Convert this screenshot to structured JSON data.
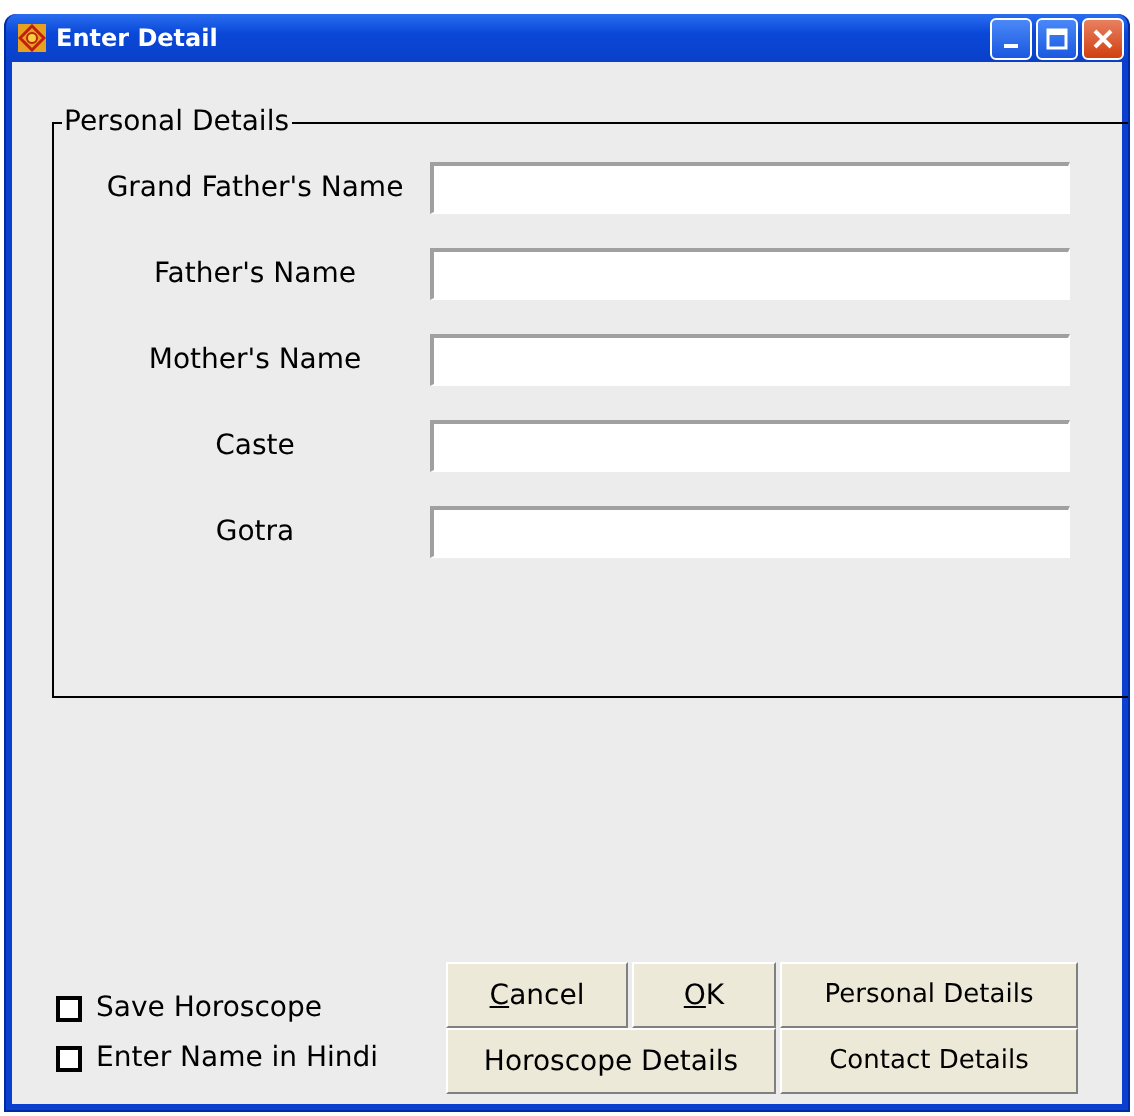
{
  "window": {
    "title": "Enter Detail"
  },
  "personal_details": {
    "legend": "Personal Details",
    "fields": [
      {
        "label": "Grand Father's Name"
      },
      {
        "label": "Father's Name"
      },
      {
        "label": "Mother's Name"
      },
      {
        "label": "Caste"
      },
      {
        "label": "Gotra"
      }
    ]
  },
  "options": [
    {
      "label": "Save Horoscope",
      "checked": false
    },
    {
      "label": "Enter Name in Hindi",
      "checked": false
    }
  ],
  "buttons": [
    {
      "label": "Cancel",
      "mnemonic_first": true
    },
    {
      "label": "OK",
      "mnemonic_first": true
    },
    {
      "label": "Personal Details",
      "mnemonic_first": false
    },
    {
      "label": "Horoscope Details",
      "mnemonic_first": false
    },
    {
      "label": "Contact Details",
      "mnemonic_first": false
    }
  ]
}
